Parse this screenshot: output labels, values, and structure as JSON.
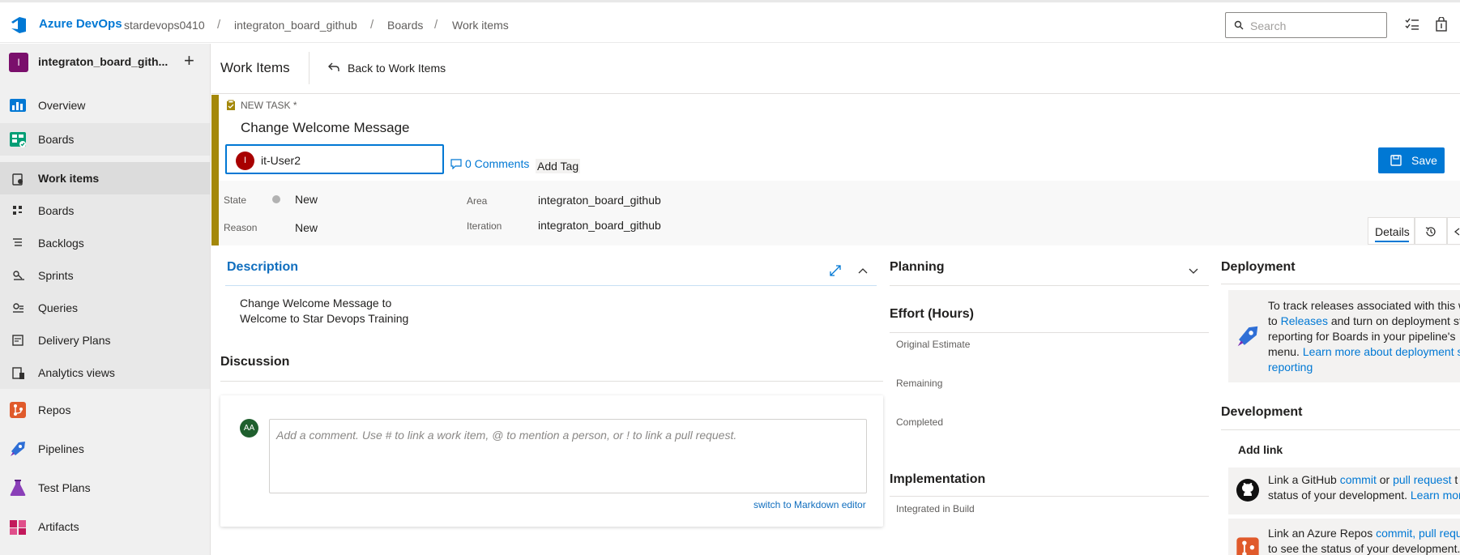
{
  "topbar": {
    "brand": "Azure DevOps",
    "breadcrumbs": [
      "stardevops0410",
      "integraton_board_github",
      "Boards",
      "Work items"
    ],
    "search_placeholder": "Search"
  },
  "sidebar": {
    "project_initial": "I",
    "project_name": "integraton_board_gith...",
    "items": [
      {
        "label": "Overview",
        "icon": "overview-icon"
      },
      {
        "label": "Boards",
        "icon": "boards-icon"
      },
      {
        "label": "Work items",
        "icon": "work-items-icon"
      },
      {
        "label": "Boards",
        "icon": "kanban-icon"
      },
      {
        "label": "Backlogs",
        "icon": "backlog-icon"
      },
      {
        "label": "Sprints",
        "icon": "sprints-icon"
      },
      {
        "label": "Queries",
        "icon": "queries-icon"
      },
      {
        "label": "Delivery Plans",
        "icon": "delivery-plans-icon"
      },
      {
        "label": "Analytics views",
        "icon": "analytics-icon"
      },
      {
        "label": "Repos",
        "icon": "repos-icon"
      },
      {
        "label": "Pipelines",
        "icon": "pipelines-icon"
      },
      {
        "label": "Test Plans",
        "icon": "test-plans-icon"
      },
      {
        "label": "Artifacts",
        "icon": "artifacts-icon"
      }
    ]
  },
  "header": {
    "title": "Work Items",
    "back_label": "Back to Work Items"
  },
  "form": {
    "type_label": "NEW TASK *",
    "title": "Change Welcome Message",
    "assigned_initial": "I",
    "assigned_value": "it-User2",
    "comments_label": "0 Comments",
    "add_tag_label": "Add Tag",
    "save_label": "Save",
    "state_label": "State",
    "state_value": "New",
    "reason_label": "Reason",
    "reason_value": "New",
    "area_label": "Area",
    "area_value": "integraton_board_github",
    "iteration_label": "Iteration",
    "iteration_value": "integraton_board_github",
    "tab_details": "Details"
  },
  "description": {
    "title": "Description",
    "line1": "Change Welcome Message to",
    "line2": "Welcome to Star Devops Training"
  },
  "discussion": {
    "title": "Discussion",
    "avatar": "AA",
    "placeholder": "Add a comment. Use # to link a work item, @ to mention a person, or ! to link a pull request.",
    "switch_label": "switch to Markdown editor"
  },
  "planning": {
    "title": "Planning",
    "effort_title": "Effort (Hours)",
    "original_estimate": "Original Estimate",
    "remaining": "Remaining",
    "completed": "Completed",
    "implementation_title": "Implementation",
    "integrated_in_build": "Integrated in Build"
  },
  "deployment": {
    "title": "Deployment",
    "l1": "To track releases associated with this w",
    "l2_pre": "to ",
    "l2_link": "Releases",
    "l2_post": " and turn on deployment st",
    "l3": "reporting for Boards in your pipeline's",
    "l4_pre": "menu. ",
    "l4_link": "Learn more about deployment s",
    "l5_link": "reporting"
  },
  "development": {
    "title": "Development",
    "add_link": "Add link",
    "gh_l1_pre": "Link a GitHub ",
    "gh_l1_link1": "commit",
    "gh_l1_mid": " or ",
    "gh_l1_link2": "pull request",
    "gh_l1_post": " t",
    "gh_l2_pre": "status of your development. ",
    "gh_l2_link": "Learn mor",
    "az_l1_pre": "Link an Azure Repos ",
    "az_l1_link": "commit, pull reque",
    "az_l2": "to see the status of your development."
  },
  "colors": {
    "accent": "#0078d4",
    "task_bar": "#a4880a",
    "avatar_red": "#a80000"
  }
}
